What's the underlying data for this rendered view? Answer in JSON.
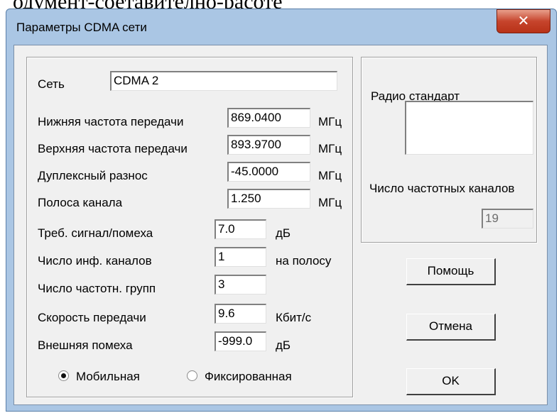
{
  "background_text": "одумент-соетавително-расоте",
  "window": {
    "title": "Параметры CDMA сети",
    "close_glyph": "✕"
  },
  "network": {
    "label": "Сеть",
    "value": "CDMA 2"
  },
  "params": [
    {
      "label": "Нижняя частота передачи",
      "value": "869.0400",
      "unit": "МГц"
    },
    {
      "label": "Верхняя частота передачи",
      "value": "893.9700",
      "unit": "МГц"
    },
    {
      "label": "Дуплексный разнос",
      "value": "-45.0000",
      "unit": "МГц"
    },
    {
      "label": "Полоса канала",
      "value": "1.250",
      "unit": "МГц"
    },
    {
      "label": "Треб. сигнал/помеха",
      "value": "7.0",
      "unit": "дБ"
    },
    {
      "label": "Число инф. каналов",
      "value": "1",
      "unit": "на полосу"
    },
    {
      "label": "Число частотн. групп",
      "value": "3",
      "unit": ""
    },
    {
      "label": "Скорость передачи",
      "value": "9.6",
      "unit": "Кбит/с"
    },
    {
      "label": "Внешняя помеха",
      "value": "-999.0",
      "unit": "дБ"
    }
  ],
  "mode": {
    "options": [
      "Мобильная",
      "Фиксированная"
    ],
    "selected": "Мобильная"
  },
  "radio_standard": {
    "label": "Радио стандарт",
    "value": ""
  },
  "freq_channels": {
    "label": "Число частотных каналов",
    "value": "19"
  },
  "buttons": {
    "help": "Помощь",
    "cancel": "Отмена",
    "ok": "OK"
  }
}
